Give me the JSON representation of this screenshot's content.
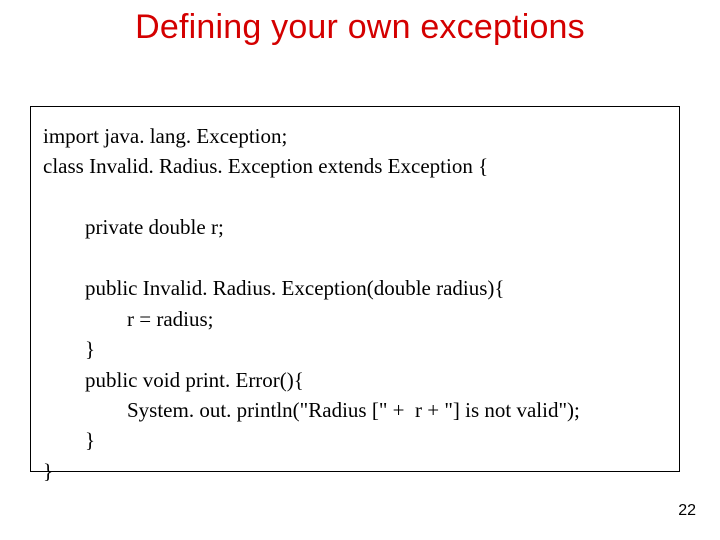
{
  "title": "Defining your own exceptions",
  "code_lines": [
    "import java. lang. Exception;",
    "class Invalid. Radius. Exception extends Exception {",
    "",
    "        private double r;",
    "",
    "        public Invalid. Radius. Exception(double radius){",
    "                r = radius;",
    "        }",
    "        public void print. Error(){",
    "                System. out. println(\"Radius [\" +  r + \"] is not valid\");",
    "        }",
    "}"
  ],
  "page_number": "22"
}
